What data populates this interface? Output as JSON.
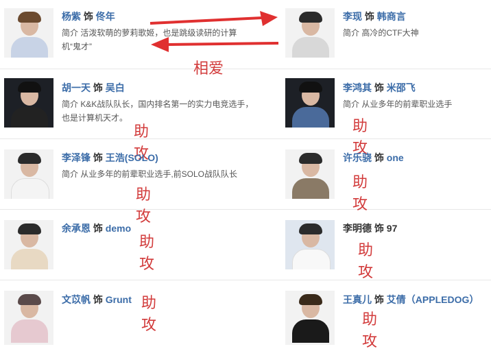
{
  "cast": [
    {
      "actor": "杨紫",
      "conn": " 饰 ",
      "role": "佟年",
      "desc_line1": "简介  活泼软萌的萝莉歌姬，也是跳级读研的计算",
      "desc_line2": "机“鬼才”",
      "tag": ""
    },
    {
      "actor": "李现",
      "conn": " 饰 ",
      "role": "韩商言",
      "desc_line1": "简介  高冷的CTF大神",
      "desc_line2": "",
      "tag": ""
    },
    {
      "actor": "胡一天",
      "conn": " 饰 ",
      "role": "吴白",
      "desc_line1": "简介  K&K战队队长，国内排名第一的实力电竞选手，",
      "desc_line2": "也是计算机天才。",
      "tag": "助攻"
    },
    {
      "actor": "李鸿其",
      "conn": " 饰 ",
      "role": "米邵飞",
      "desc_line1": "简介  从业多年的前辈职业选手",
      "desc_line2": "",
      "tag": "助攻"
    },
    {
      "actor": "李泽锋",
      "conn": " 饰 ",
      "role": "王浩(SOLO)",
      "desc_line1": "简介  从业多年的前辈职业选手,前SOLO战队队长",
      "desc_line2": "",
      "tag": "助攻"
    },
    {
      "actor": "许乐骁",
      "conn": " 饰 ",
      "role": "one",
      "desc_line1": "",
      "desc_line2": "",
      "tag": "助攻"
    },
    {
      "actor": "余承恩",
      "conn": " 饰 ",
      "role": "demo",
      "desc_line1": "",
      "desc_line2": "",
      "tag": "助攻"
    },
    {
      "actor": "李明德",
      "conn": " 饰 ",
      "role": "97",
      "desc_line1": "",
      "desc_line2": "",
      "tag": "助攻"
    },
    {
      "actor": "文苡帆",
      "conn": " 饰 ",
      "role": "Grunt",
      "desc_line1": "",
      "desc_line2": "",
      "tag": "助攻"
    },
    {
      "actor": "王真儿",
      "conn": " 饰 ",
      "role": "艾倩（APPLEDOG）",
      "desc_line1": "",
      "desc_line2": "",
      "tag": "助攻"
    }
  ],
  "relation_label": "相爱",
  "colors": {
    "name": "#3b6ca8",
    "annotation": "#d23b3b",
    "arrow": "#e03030"
  }
}
